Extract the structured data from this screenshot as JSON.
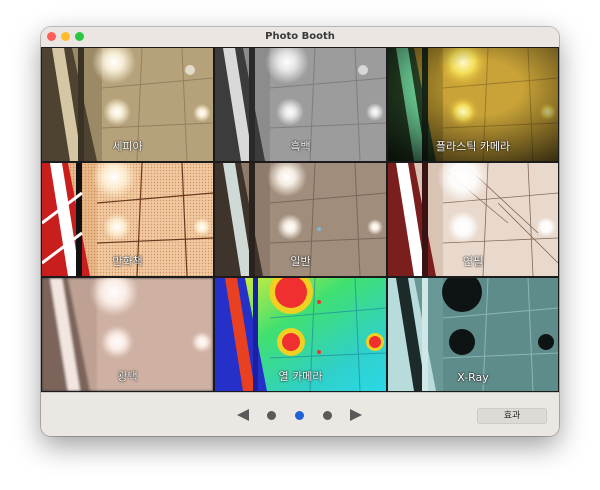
{
  "window": {
    "title": "Photo Booth"
  },
  "effects": [
    {
      "id": "sepia",
      "label": "세피아",
      "icon": "ceiling-lights-sepia"
    },
    {
      "id": "bw",
      "label": "흑백",
      "icon": "ceiling-lights-bw"
    },
    {
      "id": "plastic",
      "label": "플라스틱 카메라",
      "icon": "ceiling-lights-plastic-camera"
    },
    {
      "id": "comic",
      "label": "만화책",
      "icon": "ceiling-lights-comic"
    },
    {
      "id": "normal",
      "label": "일반",
      "icon": "ceiling-lights-normal"
    },
    {
      "id": "pencil",
      "label": "연필",
      "icon": "ceiling-lights-pencil"
    },
    {
      "id": "glow",
      "label": "광택",
      "icon": "ceiling-lights-glow"
    },
    {
      "id": "thermal",
      "label": "열 카메라",
      "icon": "ceiling-lights-thermal"
    },
    {
      "id": "xray",
      "label": "X-Ray",
      "icon": "ceiling-lights-xray"
    }
  ],
  "pager": {
    "current_page": 2,
    "total_pages": 3
  },
  "toolbar": {
    "effects_button": "효과"
  },
  "colors": {
    "active_dot": "#1e63d6",
    "inactive_dot": "#5a5a5a"
  }
}
